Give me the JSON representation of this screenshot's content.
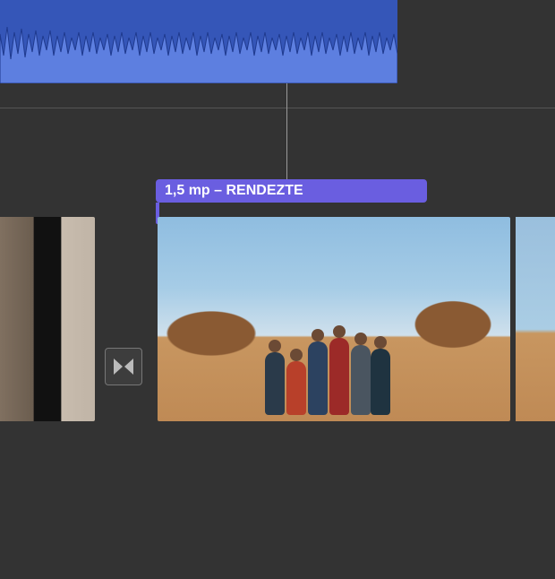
{
  "timeline": {
    "title_overlay": {
      "label": "1,5 mp – RENDEZTE",
      "duration_sec": 1.5,
      "name": "RENDEZTE"
    },
    "transition": {
      "type": "cross-dissolve"
    },
    "clips": [
      {
        "id": "clip-1",
        "has_audio": true
      },
      {
        "id": "clip-2",
        "has_audio": true,
        "has_title": true
      },
      {
        "id": "clip-3",
        "has_audio": true
      }
    ]
  }
}
